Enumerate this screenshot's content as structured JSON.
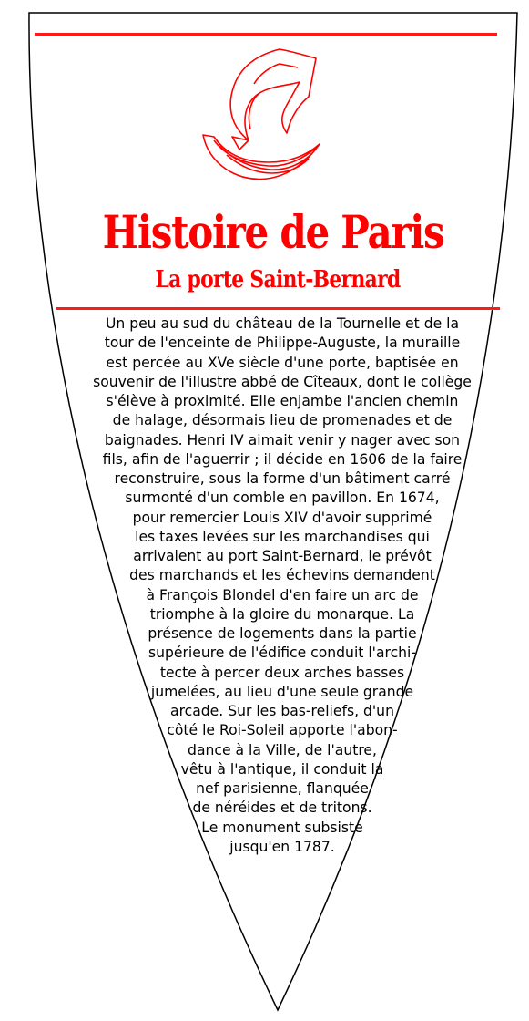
{
  "plaque": {
    "title": "Histoire de Paris",
    "subtitle": "La porte Saint-Bernard",
    "body_lines": [
      "Un peu au sud du château de la Tournelle et de la",
      "tour de l'enceinte de Philippe-Auguste, la muraille",
      "est percée au XVe siècle d'une porte, baptisée en",
      "souvenir de l'illustre abbé de Cîteaux, dont le collège",
      "s'élève à proximité. Elle enjambe l'ancien chemin",
      "de halage, désormais lieu de promenades et de",
      "baignades. Henri IV aimait venir y nager avec son",
      "fils, afin de l'aguerrir ; il décide en 1606 de la faire",
      "reconstruire, sous la forme d'un bâtiment carré",
      "surmonté d'un comble en pavillon. En 1674,",
      "pour remercier Louis XIV d'avoir supprimé",
      "les taxes levées sur les marchandises qui",
      "arrivaient au port Saint-Bernard, le prévôt",
      "des marchands et les échevins demandent",
      "à François Blondel d'en faire un arc de",
      "triomphe à la gloire du monarque. La",
      "présence de logements dans la partie",
      "supérieure de l'édifice conduit l'archi-",
      "tecte à percer deux arches basses",
      "jumelées, au lieu d'une seule grande",
      "arcade. Sur les bas-reliefs, d'un",
      "côté le Roi-Soleil apporte l'abon-",
      "dance à la Ville, de l'autre,",
      "vêtu à l'antique, il conduit la",
      "nef parisienne, flanquée",
      "de néréides et de tritons.",
      "Le monument subsiste",
      "jusqu'en 1787."
    ]
  },
  "colors": {
    "accent": "#ff0000",
    "outline": "#000000",
    "background": "#ffffff"
  },
  "icons": {
    "emblem": "paris-ship-logo"
  }
}
